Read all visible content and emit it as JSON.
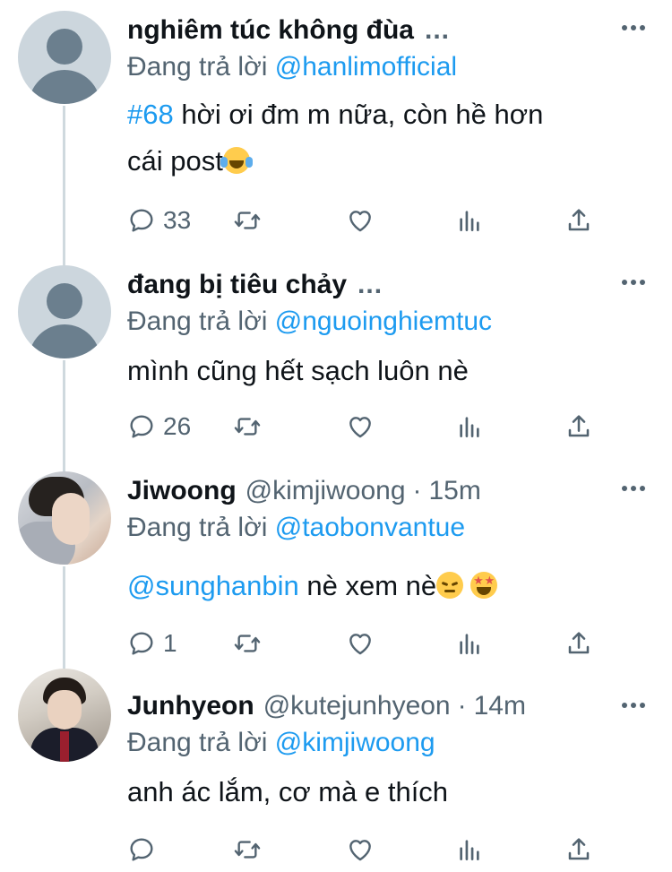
{
  "tweets": [
    {
      "name": "nghiêm túc không đùa",
      "handle": "",
      "time": "",
      "truncated": "...",
      "reply_prefix": "Đang trả lời",
      "reply_to": "@hanlimofficial",
      "text_lines": [
        {
          "link": "#68",
          "text": " hời ơi đm m nữa, còn hề hơn"
        },
        {
          "link": "",
          "text": "cái post",
          "emoji": "face-with-tears-of-joy"
        }
      ],
      "reply_count": "33",
      "avatar": "default-avatar"
    },
    {
      "name": "đang bị tiêu chảy",
      "handle": "",
      "time": "",
      "truncated": "...",
      "reply_prefix": "Đang trả lời",
      "reply_to": "@nguoinghiemtuc",
      "text_lines": [
        {
          "link": "",
          "text": "mình cũng hết sạch luôn nè"
        }
      ],
      "reply_count": "26",
      "avatar": "default-avatar"
    },
    {
      "name": "Jiwoong",
      "handle": "@kimjiwoong",
      "separator": "·",
      "time": "15m",
      "reply_prefix": "Đang trả lời",
      "reply_to": "@taobonvantue",
      "text_lines": [
        {
          "link": "@sunghanbin",
          "text": " nè xem nè",
          "emoji": "pensive-face",
          "emoji2": "star-struck"
        }
      ],
      "reply_count": "1",
      "avatar": "profile-photo"
    },
    {
      "name": "Junhyeon",
      "handle": "@kutejunhyeon",
      "separator": "·",
      "time": "14m",
      "reply_prefix": "Đang trả lời",
      "reply_to": "@kimjiwoong",
      "text_lines": [
        {
          "link": "",
          "text": "anh ác lắm, cơ mà e thích"
        }
      ],
      "reply_count": "",
      "avatar": "profile-photo"
    }
  ],
  "icons": {
    "reply": "reply-icon",
    "retweet": "retweet-icon",
    "like": "heart-icon",
    "views": "analytics-icon",
    "share": "share-icon",
    "more": "more-options-icon"
  },
  "colors": {
    "accent": "#1d9bf0",
    "secondary_text": "#536471",
    "thread_line": "#cfd9de",
    "avatar_placeholder": "#ccd6dd"
  }
}
